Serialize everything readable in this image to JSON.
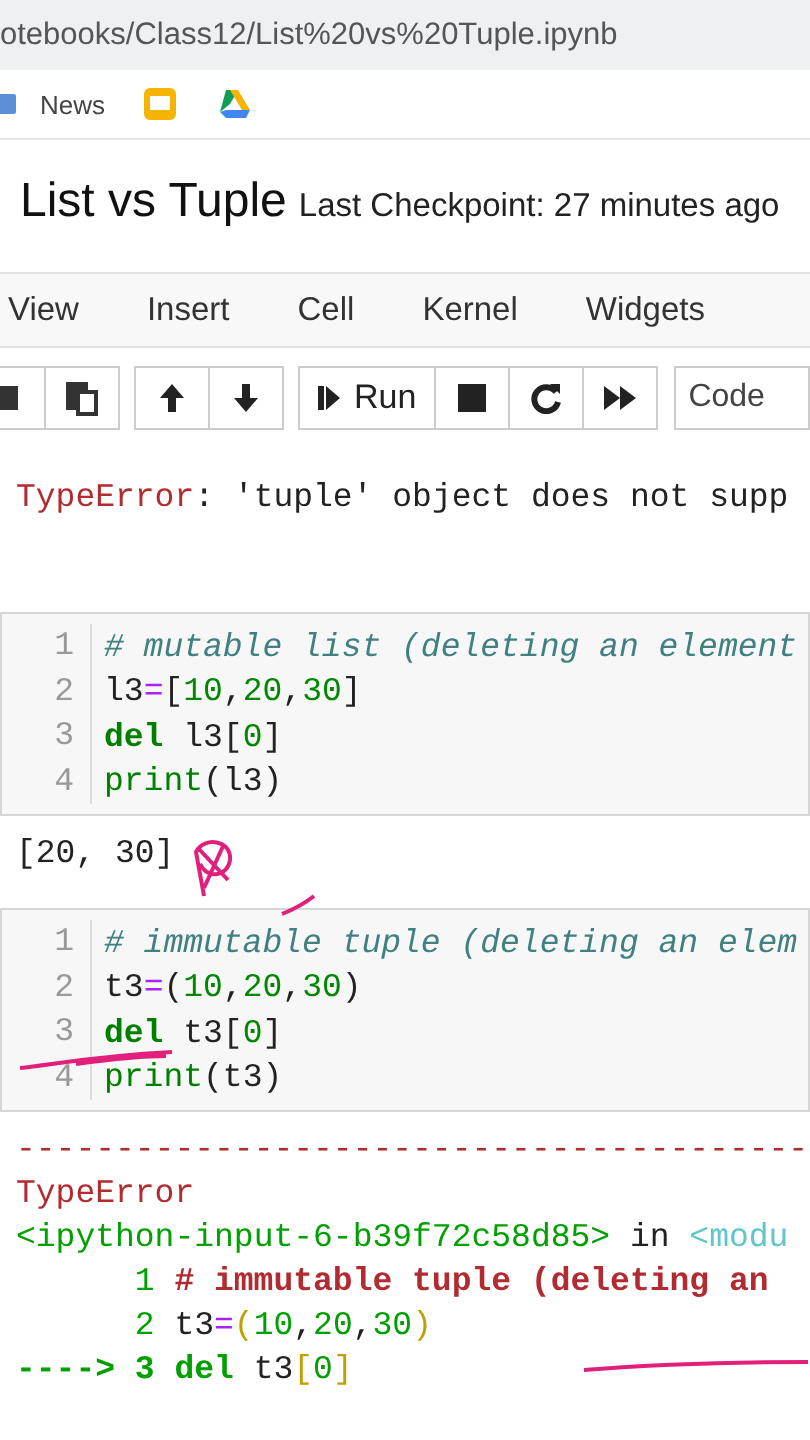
{
  "address_bar": {
    "url": "otebooks/Class12/List%20vs%20Tuple.ipynb"
  },
  "bookmarks": [
    {
      "kind": "folder",
      "label": "News"
    },
    {
      "kind": "slides"
    },
    {
      "kind": "drive"
    }
  ],
  "notebook": {
    "title": "List vs Tuple",
    "checkpoint": "Last Checkpoint: 27 minutes ago"
  },
  "menu": [
    "View",
    "Insert",
    "Cell",
    "Kernel",
    "Widgets"
  ],
  "toolbar": [
    [
      {
        "kind": "copy"
      },
      {
        "kind": "paste"
      }
    ],
    [
      {
        "kind": "up"
      },
      {
        "kind": "down"
      }
    ],
    [
      {
        "kind": "run",
        "label": "Run"
      },
      {
        "kind": "stop"
      },
      {
        "kind": "restart"
      },
      {
        "kind": "fastforward"
      }
    ]
  ],
  "cell_type": "Code",
  "previous_output": [
    {
      "kind": "ename",
      "text": "TypeError"
    },
    {
      "kind": "plain",
      "text": ": 'tuple' object does not supp"
    }
  ],
  "cells": [
    {
      "lines": [
        {
          "number": "1",
          "tokens": [
            {
              "kind": "comment",
              "text": "# mutable list (deleting an element"
            }
          ]
        },
        {
          "number": "2",
          "tokens": [
            {
              "kind": "plain",
              "text": "l3"
            },
            {
              "kind": "op",
              "text": "="
            },
            {
              "kind": "plain",
              "text": "["
            },
            {
              "kind": "number",
              "text": "10"
            },
            {
              "kind": "plain",
              "text": ","
            },
            {
              "kind": "number",
              "text": "20"
            },
            {
              "kind": "plain",
              "text": ","
            },
            {
              "kind": "number",
              "text": "30"
            },
            {
              "kind": "plain",
              "text": "]"
            }
          ]
        },
        {
          "number": "3",
          "tokens": [
            {
              "kind": "keyword",
              "text": "del"
            },
            {
              "kind": "plain",
              "text": " l3["
            },
            {
              "kind": "number",
              "text": "0"
            },
            {
              "kind": "plain",
              "text": "]"
            }
          ]
        },
        {
          "number": "4",
          "tokens": [
            {
              "kind": "builtin",
              "text": "print"
            },
            {
              "kind": "plain",
              "text": "(l3)"
            }
          ]
        }
      ],
      "output": [
        [
          {
            "kind": "plain",
            "text": "[20, 30]"
          }
        ]
      ]
    },
    {
      "lines": [
        {
          "number": "1",
          "tokens": [
            {
              "kind": "comment",
              "text": "# immutable tuple (deleting an elem"
            }
          ]
        },
        {
          "number": "2",
          "tokens": [
            {
              "kind": "plain",
              "text": "t3"
            },
            {
              "kind": "op",
              "text": "="
            },
            {
              "kind": "plain",
              "text": "("
            },
            {
              "kind": "number",
              "text": "10"
            },
            {
              "kind": "plain",
              "text": ","
            },
            {
              "kind": "number",
              "text": "20"
            },
            {
              "kind": "plain",
              "text": ","
            },
            {
              "kind": "number",
              "text": "30"
            },
            {
              "kind": "plain",
              "text": ")"
            }
          ]
        },
        {
          "number": "3",
          "tokens": [
            {
              "kind": "keyword",
              "text": "del"
            },
            {
              "kind": "plain",
              "text": " t3["
            },
            {
              "kind": "number",
              "text": "0"
            },
            {
              "kind": "plain",
              "text": "]"
            }
          ]
        },
        {
          "number": "4",
          "tokens": [
            {
              "kind": "builtin",
              "text": "print"
            },
            {
              "kind": "plain",
              "text": "(t3)"
            }
          ]
        }
      ],
      "output": [
        [
          {
            "kind": "ename",
            "text": "----------------------------------------"
          }
        ],
        [
          {
            "kind": "ename",
            "text": "TypeError"
          }
        ],
        [
          {
            "kind": "path",
            "text": "<ipython-input-6-b39f72c58d85>"
          },
          {
            "kind": "plain",
            "text": " in "
          },
          {
            "kind": "module",
            "text": "<modu"
          }
        ],
        [
          {
            "kind": "gutter",
            "text": "1"
          },
          {
            "kind": "tbcomment",
            "text": "# immutable tuple (deleting an"
          }
        ],
        [
          {
            "kind": "gutter",
            "text": "2"
          },
          {
            "kind": "plain",
            "text": "t3"
          },
          {
            "kind": "op",
            "text": "="
          },
          {
            "kind": "tbnum",
            "text": "("
          },
          {
            "kind": "lineno",
            "text": "10"
          },
          {
            "kind": "plain",
            "text": ","
          },
          {
            "kind": "lineno",
            "text": "20"
          },
          {
            "kind": "plain",
            "text": ","
          },
          {
            "kind": "lineno",
            "text": "30"
          },
          {
            "kind": "tbnum",
            "text": ")"
          }
        ],
        [
          {
            "kind": "arrow",
            "text": "----> 3 del"
          },
          {
            "kind": "plain",
            "text": " t3"
          },
          {
            "kind": "tbnum",
            "text": "["
          },
          {
            "kind": "lineno",
            "text": "0"
          },
          {
            "kind": "tbnum",
            "text": "]"
          }
        ]
      ]
    }
  ]
}
